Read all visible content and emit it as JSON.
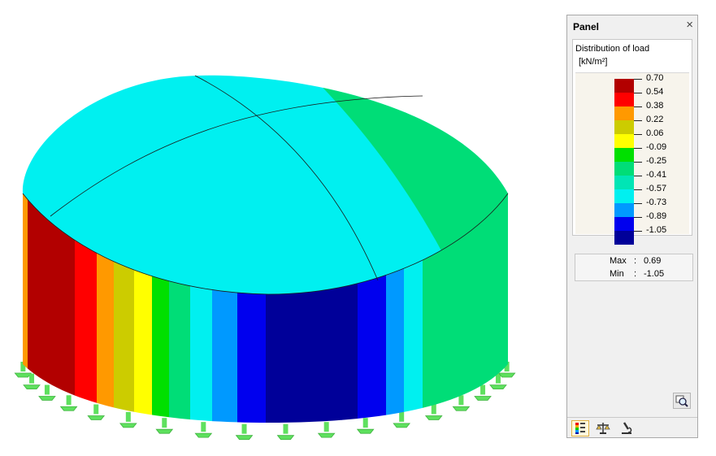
{
  "panel": {
    "title": "Panel",
    "close_symbol": "×",
    "legend": {
      "title": "Distribution of load",
      "unit": "[kN/m²]",
      "stops": [
        {
          "label": "0.70",
          "color": "#b20000"
        },
        {
          "label": "0.54",
          "color": "#ff0000"
        },
        {
          "label": "0.38",
          "color": "#ff9900"
        },
        {
          "label": "0.22",
          "color": "#cccc00"
        },
        {
          "label": "0.06",
          "color": "#ffff00"
        },
        {
          "label": "-0.09",
          "color": "#00e000"
        },
        {
          "label": "-0.25",
          "color": "#00dd77"
        },
        {
          "label": "-0.41",
          "color": "#00e5b5"
        },
        {
          "label": "-0.57",
          "color": "#00f0f0"
        },
        {
          "label": "-0.73",
          "color": "#0099ff"
        },
        {
          "label": "-0.89",
          "color": "#0000ee"
        },
        {
          "label": "-1.05",
          "color": "#000099"
        }
      ]
    },
    "max_label": "Max",
    "max_value": "0.69",
    "min_label": "Min",
    "min_value": "-1.05",
    "separator": ":",
    "icons": {
      "zoom": "magnifier-icon",
      "tab_colors": "color-scale-icon",
      "tab_balance": "balance-icon",
      "tab_microscope": "microscope-icon"
    }
  },
  "model": {
    "roof_color": "#00f0f0",
    "roof_right_color": "#00dd77",
    "roof_edge_color": "#00e000",
    "support_color": "#5ee05e",
    "wall_bands": [
      {
        "color": "#ff9900"
      },
      {
        "color": "#b20000"
      },
      {
        "color": "#b20000"
      },
      {
        "color": "#ff0000"
      },
      {
        "color": "#ff9900"
      },
      {
        "color": "#cccc00"
      },
      {
        "color": "#ffff00"
      },
      {
        "color": "#00e000"
      },
      {
        "color": "#00dd77"
      },
      {
        "color": "#00f0f0"
      },
      {
        "color": "#0099ff"
      },
      {
        "color": "#0000ee"
      },
      {
        "color": "#000099"
      },
      {
        "color": "#000099"
      },
      {
        "color": "#000099"
      },
      {
        "color": "#0000ee"
      },
      {
        "color": "#0099ff"
      },
      {
        "color": "#00f0f0"
      },
      {
        "color": "#00dd77"
      },
      {
        "color": "#00dd77"
      },
      {
        "color": "#00dd77"
      },
      {
        "color": "#00dd77"
      }
    ]
  }
}
